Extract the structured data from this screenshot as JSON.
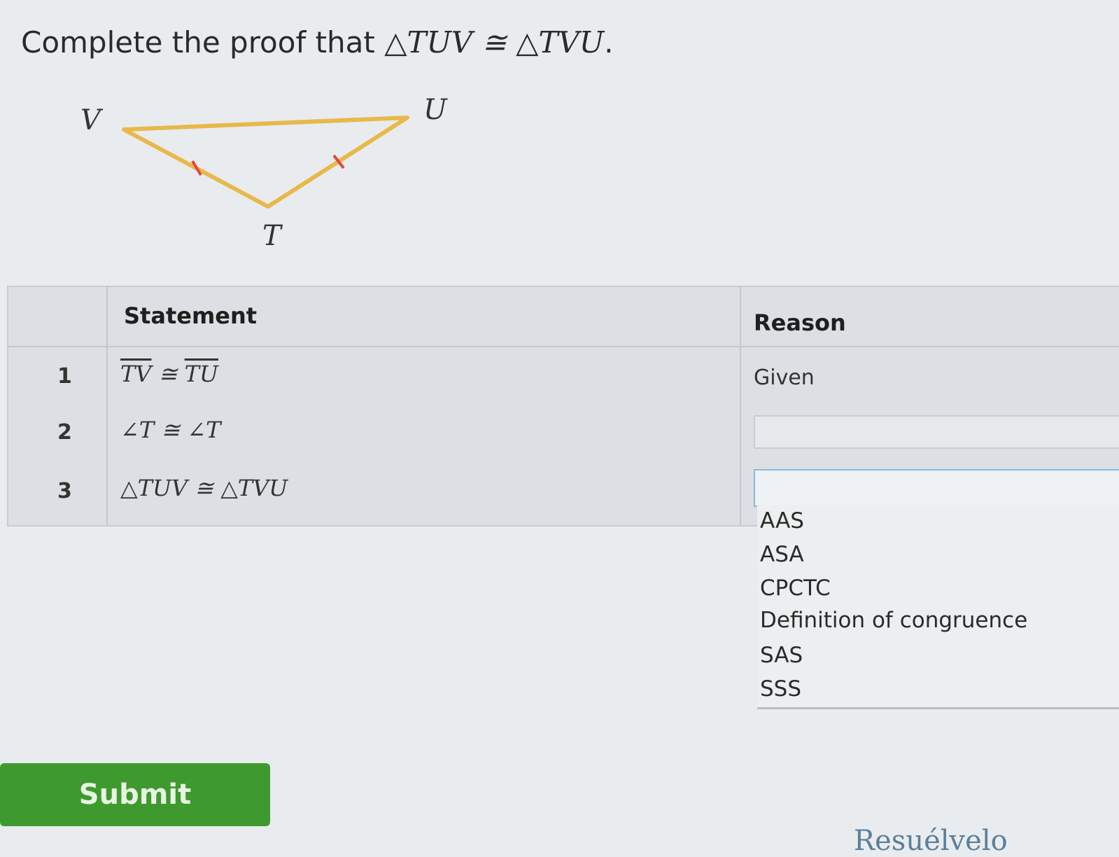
{
  "question": {
    "prefix": "Complete the proof that ",
    "math": "△TUV ≅ △TVU",
    "suffix": "."
  },
  "figure": {
    "vertices": [
      "V",
      "U",
      "T"
    ],
    "line_color": "#e8b84a",
    "tick_color": "#e2463c"
  },
  "table": {
    "headers": {
      "statement": "Statement",
      "reason": "Reason"
    },
    "rows": [
      {
        "num": "1",
        "statement_a": "TV",
        "statement_op": " ≅ ",
        "statement_b": "TU",
        "reason": "Given"
      },
      {
        "num": "2",
        "statement": "∠T ≅ ∠T",
        "reason": ""
      },
      {
        "num": "3",
        "statement": "△TUV ≅ △TVU",
        "reason": ""
      }
    ]
  },
  "dropdown": {
    "options": [
      "AAS",
      "ASA",
      "CPCTC",
      "Definition of congruence",
      "SAS",
      "SSS"
    ]
  },
  "submit_label": "Submit",
  "bottom_link": "Resuélvelo",
  "colors": {
    "submit_bg": "#3e9a2e",
    "accent_border": "#8fb8d8"
  }
}
